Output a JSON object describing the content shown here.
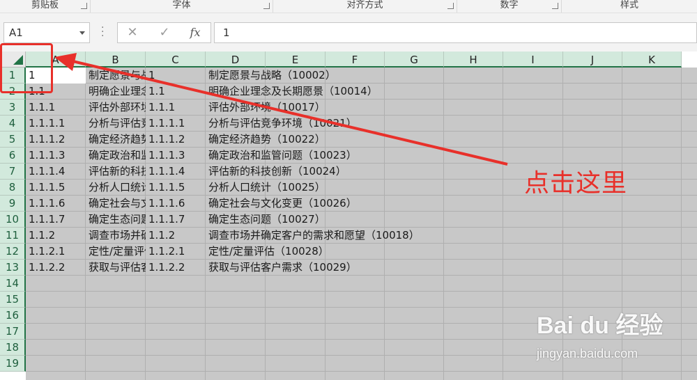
{
  "ribbon": {
    "groups": [
      "剪贴板",
      "字体",
      "对齐方式",
      "数字",
      "样式"
    ]
  },
  "formula_bar": {
    "name_box": "A1",
    "cancel_icon": "✕",
    "enter_icon": "✓",
    "fx_label": "fx",
    "value": "1"
  },
  "columns": [
    "A",
    "B",
    "C",
    "D",
    "E",
    "F",
    "G",
    "H",
    "I",
    "J",
    "K"
  ],
  "rows": [
    "1",
    "2",
    "3",
    "4",
    "5",
    "6",
    "7",
    "8",
    "9",
    "10",
    "11",
    "12",
    "13",
    "14",
    "15",
    "16",
    "17",
    "18",
    "19"
  ],
  "cells": {
    "colA": [
      "1",
      "1.1",
      "1.1.1",
      "1.1.1.1",
      "1.1.1.2",
      "1.1.1.3",
      "1.1.1.4",
      "1.1.1.5",
      "1.1.1.6",
      "1.1.1.7",
      "1.1.2",
      "1.1.2.1",
      "1.1.2.2"
    ],
    "colB": [
      "制定愿景与战略",
      "明确企业理念及长期愿景",
      "评估外部环境",
      "分析与评估竞争环境",
      "确定经济趋势",
      "确定政治和监管问题",
      "评估新的科技创新",
      "分析人口统计",
      "确定社会与文化变更",
      "确定生态问题",
      "调查市场并确定客户的需求和愿望",
      "定性/定量评估",
      "获取与评估客户需求"
    ],
    "colC": [
      "1",
      "1.1",
      "1.1.1",
      "1.1.1.1",
      "1.1.1.2",
      "1.1.1.3",
      "1.1.1.4",
      "1.1.1.5",
      "1.1.1.6",
      "1.1.1.7",
      "1.1.2",
      "1.1.2.1",
      "1.1.2.2"
    ],
    "colD": [
      "制定愿景与战略（10002）",
      "明确企业理念及长期愿景（10014）",
      "评估外部环境（10017）",
      "分析与评估竞争环境（10021）",
      "确定经济趋势（10022）",
      "确定政治和监管问题（10023）",
      "评估新的科技创新（10024）",
      "分析人口统计（10025）",
      "确定社会与文化变更（10026）",
      "确定生态问题（10027）",
      "调查市场并确定客户的需求和愿望（10018）",
      "定性/定量评估（10028）",
      "获取与评估客户需求（10029）"
    ]
  },
  "annotation": {
    "text": "点击这里",
    "color": "#e8302a"
  },
  "colors": {
    "accent_green": "#217346",
    "header_bg": "#d2e9dc",
    "selection_gray": "#c8c8c8"
  },
  "watermark": {
    "brand": "Bai du 经验",
    "url": "jingyan.baidu.com"
  }
}
